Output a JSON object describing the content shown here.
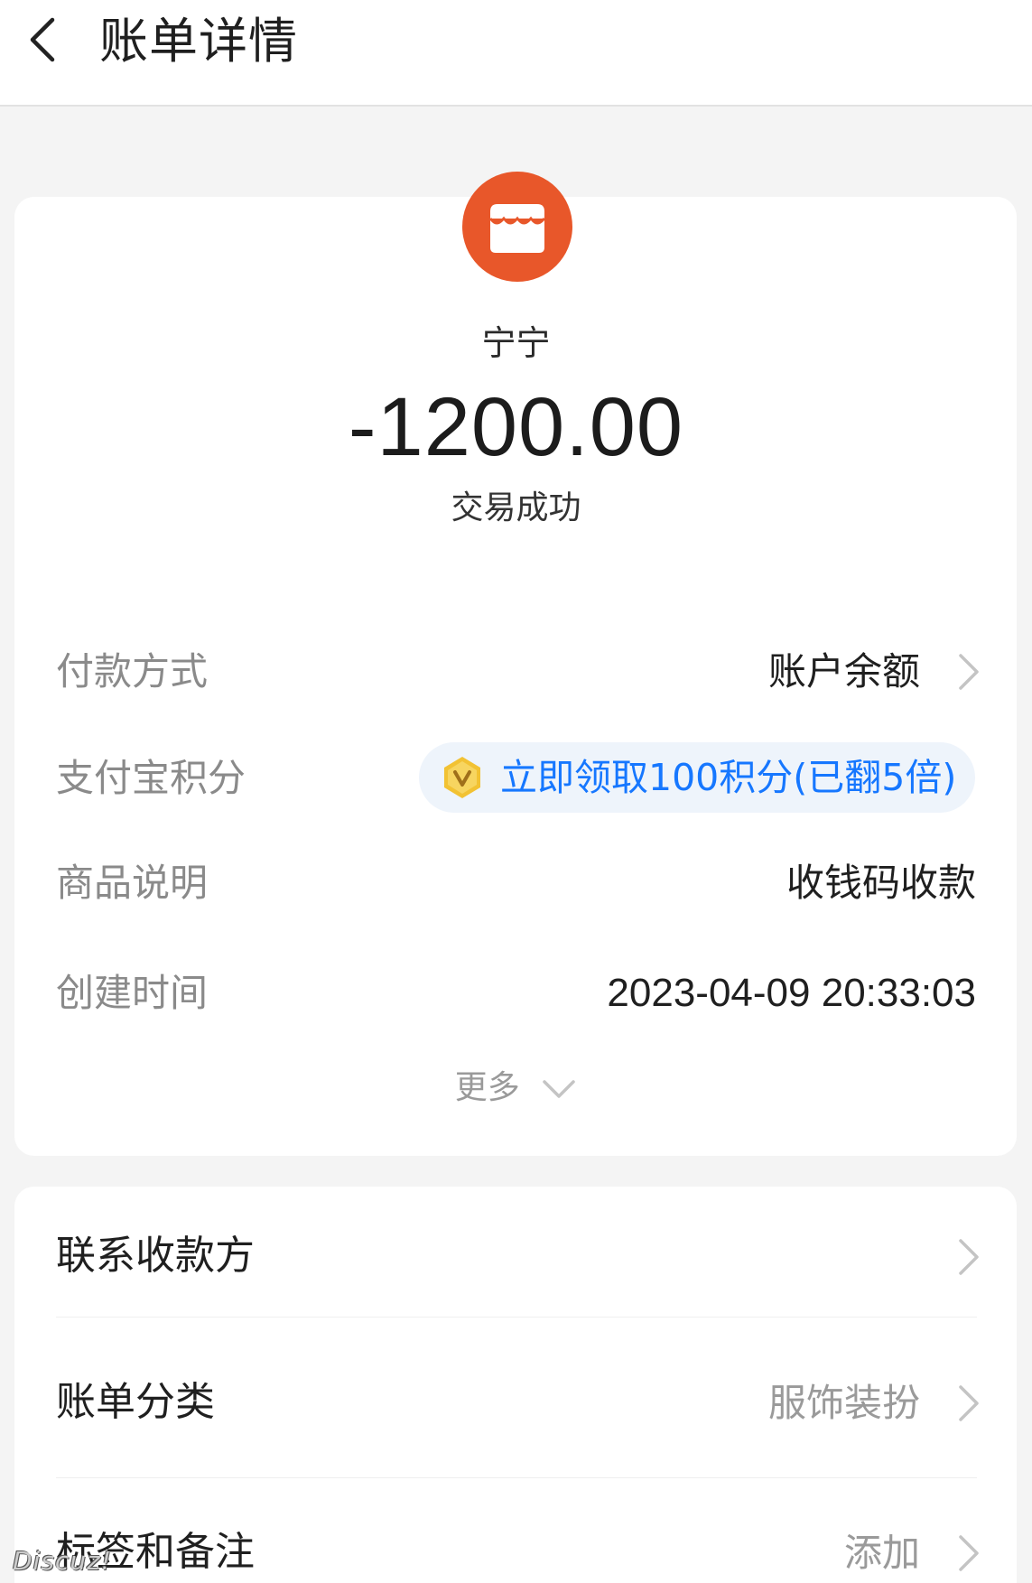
{
  "header": {
    "title": "账单详情"
  },
  "merchant": {
    "name": "宁宁",
    "amount": "-1200.00",
    "status": "交易成功",
    "logo_color": "#e8572a"
  },
  "details": {
    "payment_method": {
      "label": "付款方式",
      "value": "账户余额"
    },
    "points": {
      "label": "支付宝积分",
      "value": "立即领取100积分(已翻5倍)"
    },
    "product": {
      "label": "商品说明",
      "value": "收钱码收款"
    },
    "created_time": {
      "label": "创建时间",
      "value": "2023-04-09 20:33:03"
    },
    "more_label": "更多"
  },
  "menu": {
    "contact": {
      "label": "联系收款方"
    },
    "category": {
      "label": "账单分类",
      "value": "服饰装扮"
    },
    "tags": {
      "label": "标签和备注",
      "value": "添加"
    }
  },
  "watermark": "Discuz!",
  "colors": {
    "accent_blue": "#1677ff",
    "logo_orange": "#e8572a",
    "pill_bg": "#eef4fb",
    "coin_gold": "#f2c233"
  },
  "icons": [
    "back-arrow-icon",
    "store-icon",
    "chevron-right-icon",
    "coin-icon",
    "chevron-down-icon"
  ]
}
